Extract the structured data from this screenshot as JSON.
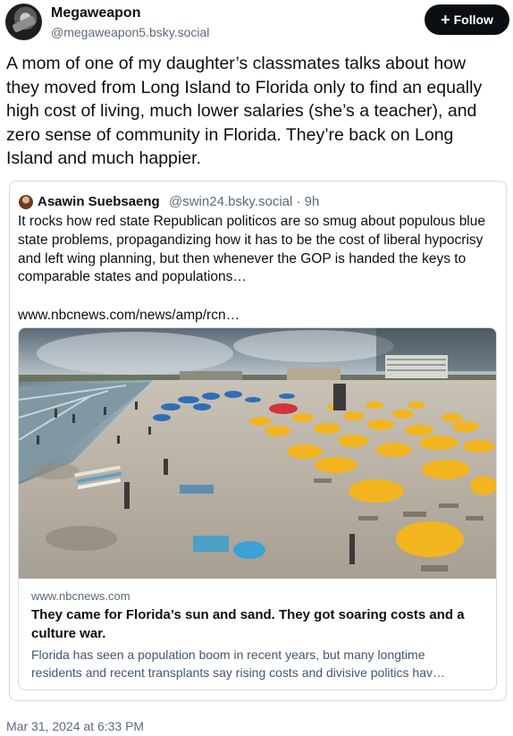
{
  "author": {
    "display_name": "Megaweapon",
    "handle": "@megaweapon5.bsky.social"
  },
  "follow_button": {
    "label": "Follow",
    "icon": "plus-icon"
  },
  "post": {
    "text": "A mom of one of my daughter’s classmates talks about how they moved from Long Island to Florida only to find an equally high cost of living, much lower salaries (she’s a teacher), and zero sense of community in Florida. They’re back on Long Island and much happier.",
    "timestamp": "Mar 31, 2024 at 6:33 PM"
  },
  "quote": {
    "author_name": "Asawin Suebsaeng",
    "meta": "@swin24.bsky.social · 9h",
    "text": "It rocks how red state Republican politicos are so smug about populous blue state problems, propagandizing how it has to be the cost of liberal hypocrisy and left wing planning, but then whenever the GOP is handed the keys to comparable states and populations…",
    "link": "www.nbcnews.com/news/amp/rcn…"
  },
  "link_card": {
    "domain": "www.nbcnews.com",
    "title": "They came for Florida’s sun and sand. They got soaring costs and a culture war.",
    "description_line1": "Florida has seen a population boom in recent years, but many longtime",
    "description_line2": "residents and recent transplants say rising costs and divisive politics hav…"
  },
  "colors": {
    "text": "#0b0f14",
    "muted": "#5b6b7c",
    "border": "#d4dbe2",
    "umbrella": "#f2b51f"
  }
}
